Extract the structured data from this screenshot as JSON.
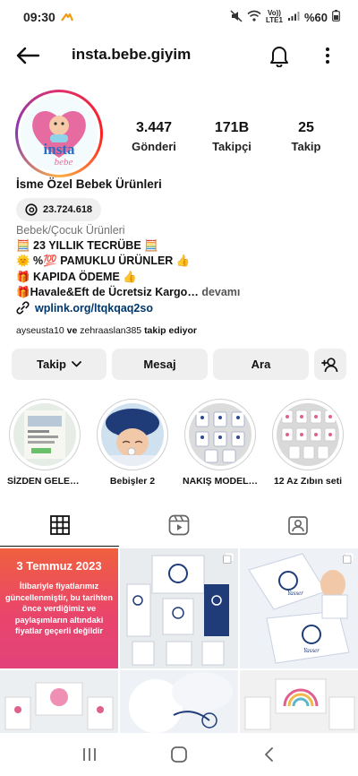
{
  "status_bar": {
    "time": "09:30",
    "network_label": "Vo))",
    "network_sub": "LTE1",
    "battery": "%60"
  },
  "header": {
    "username": "insta.bebe.giyim"
  },
  "profile": {
    "avatar_text": "insta",
    "avatar_subtext": "bebe",
    "stats": [
      {
        "value": "3.447",
        "label": "Gönderi"
      },
      {
        "value": "171B",
        "label": "Takipçi"
      },
      {
        "value": "25",
        "label": "Takip"
      }
    ],
    "display_name": "İsme Özel Bebek Ürünleri",
    "threads_count": "23.724.618",
    "category": "Bebek/Çocuk Ürünleri",
    "bio": [
      "🧮 23 YILLIK TECRÜBE 🧮",
      "🌞 %💯 PAMUKLU ÜRÜNLER 👍",
      "🎁 KAPIDA ÖDEME 👍",
      "🎁Havale&Eft de Ücretsiz Kargo…"
    ],
    "bio_more": "devamı",
    "link": "wplink.org/ltqkqaq2so",
    "followed_by_names": "ayseusta10",
    "followed_by_and": "ve",
    "followed_by_names_2": "zehraaslan385",
    "followed_by_suffix": "takip ediyor"
  },
  "actions": {
    "follow": "Takip",
    "message": "Mesaj",
    "call": "Ara"
  },
  "highlights": [
    {
      "label": "SİZDEN GELENLE..."
    },
    {
      "label": "Bebişler 2"
    },
    {
      "label": "NAKIŞ MODELLERİ"
    },
    {
      "label": "12 Az Zıbın seti"
    }
  ],
  "posts": {
    "announcement_title": "3 Temmuz 2023",
    "announcement_body": "İtibariyle fiyatlarımız güncellenmiştir, bu tarihten önce verdiğimiz ve paylaşımların altındaki fiyatlar geçerli değildir",
    "embroidery_names": [
      "Yasser",
      "Yasser"
    ]
  },
  "colors": {
    "accent_link": "#00376b",
    "button_bg": "#efefef",
    "announce_gradient_start": "#f0603e",
    "announce_gradient_end": "#e2427a"
  },
  "icons": {
    "back": "arrow-left-icon",
    "bell": "bell-icon",
    "more": "more-vertical-icon",
    "threads": "threads-icon",
    "link": "link-icon",
    "chevron": "chevron-down-icon",
    "add_user": "add-user-icon",
    "grid": "grid-icon",
    "reels": "reels-icon",
    "tagged": "tagged-icon"
  }
}
